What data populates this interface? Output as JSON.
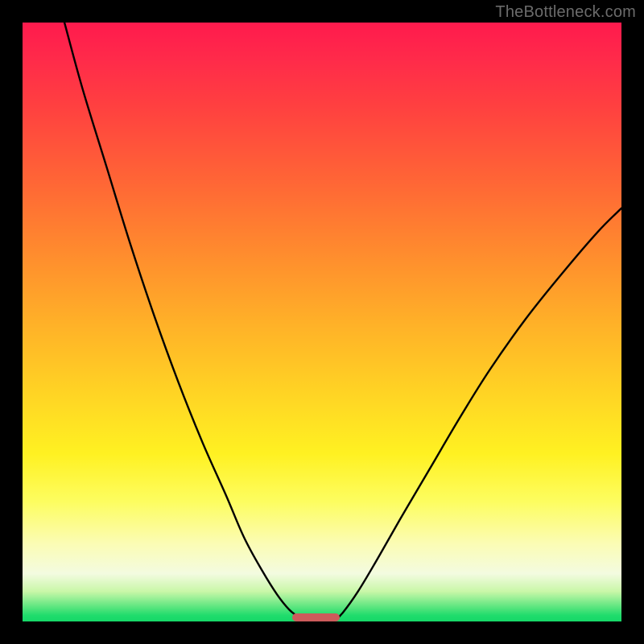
{
  "watermark": "TheBottleneck.com",
  "chart_data": {
    "type": "line",
    "title": "",
    "xlabel": "",
    "ylabel": "",
    "xlim": [
      0,
      100
    ],
    "ylim": [
      0,
      100
    ],
    "grid": false,
    "series": [
      {
        "name": "left-curve",
        "x": [
          7,
          10,
          14,
          18,
          22,
          26,
          30,
          34,
          37,
          40,
          42.5,
          44.5,
          46,
          47
        ],
        "y": [
          100,
          89,
          76,
          63,
          51,
          40,
          30,
          21,
          14,
          8.5,
          4.5,
          2,
          0.8,
          0
        ]
      },
      {
        "name": "right-curve",
        "x": [
          52,
          53.5,
          56,
          59,
          63,
          68,
          73,
          78,
          84,
          90,
          96,
          100
        ],
        "y": [
          0,
          1.5,
          5,
          10,
          17,
          25.5,
          34,
          42,
          50.5,
          58,
          65,
          69
        ]
      }
    ],
    "optimal_range_x": [
      45,
      53
    ],
    "gradient_stops": [
      {
        "pos": 0,
        "color": "#ff1a4d"
      },
      {
        "pos": 50,
        "color": "#ffb028"
      },
      {
        "pos": 80,
        "color": "#fdfd60"
      },
      {
        "pos": 100,
        "color": "#16d868"
      }
    ]
  }
}
